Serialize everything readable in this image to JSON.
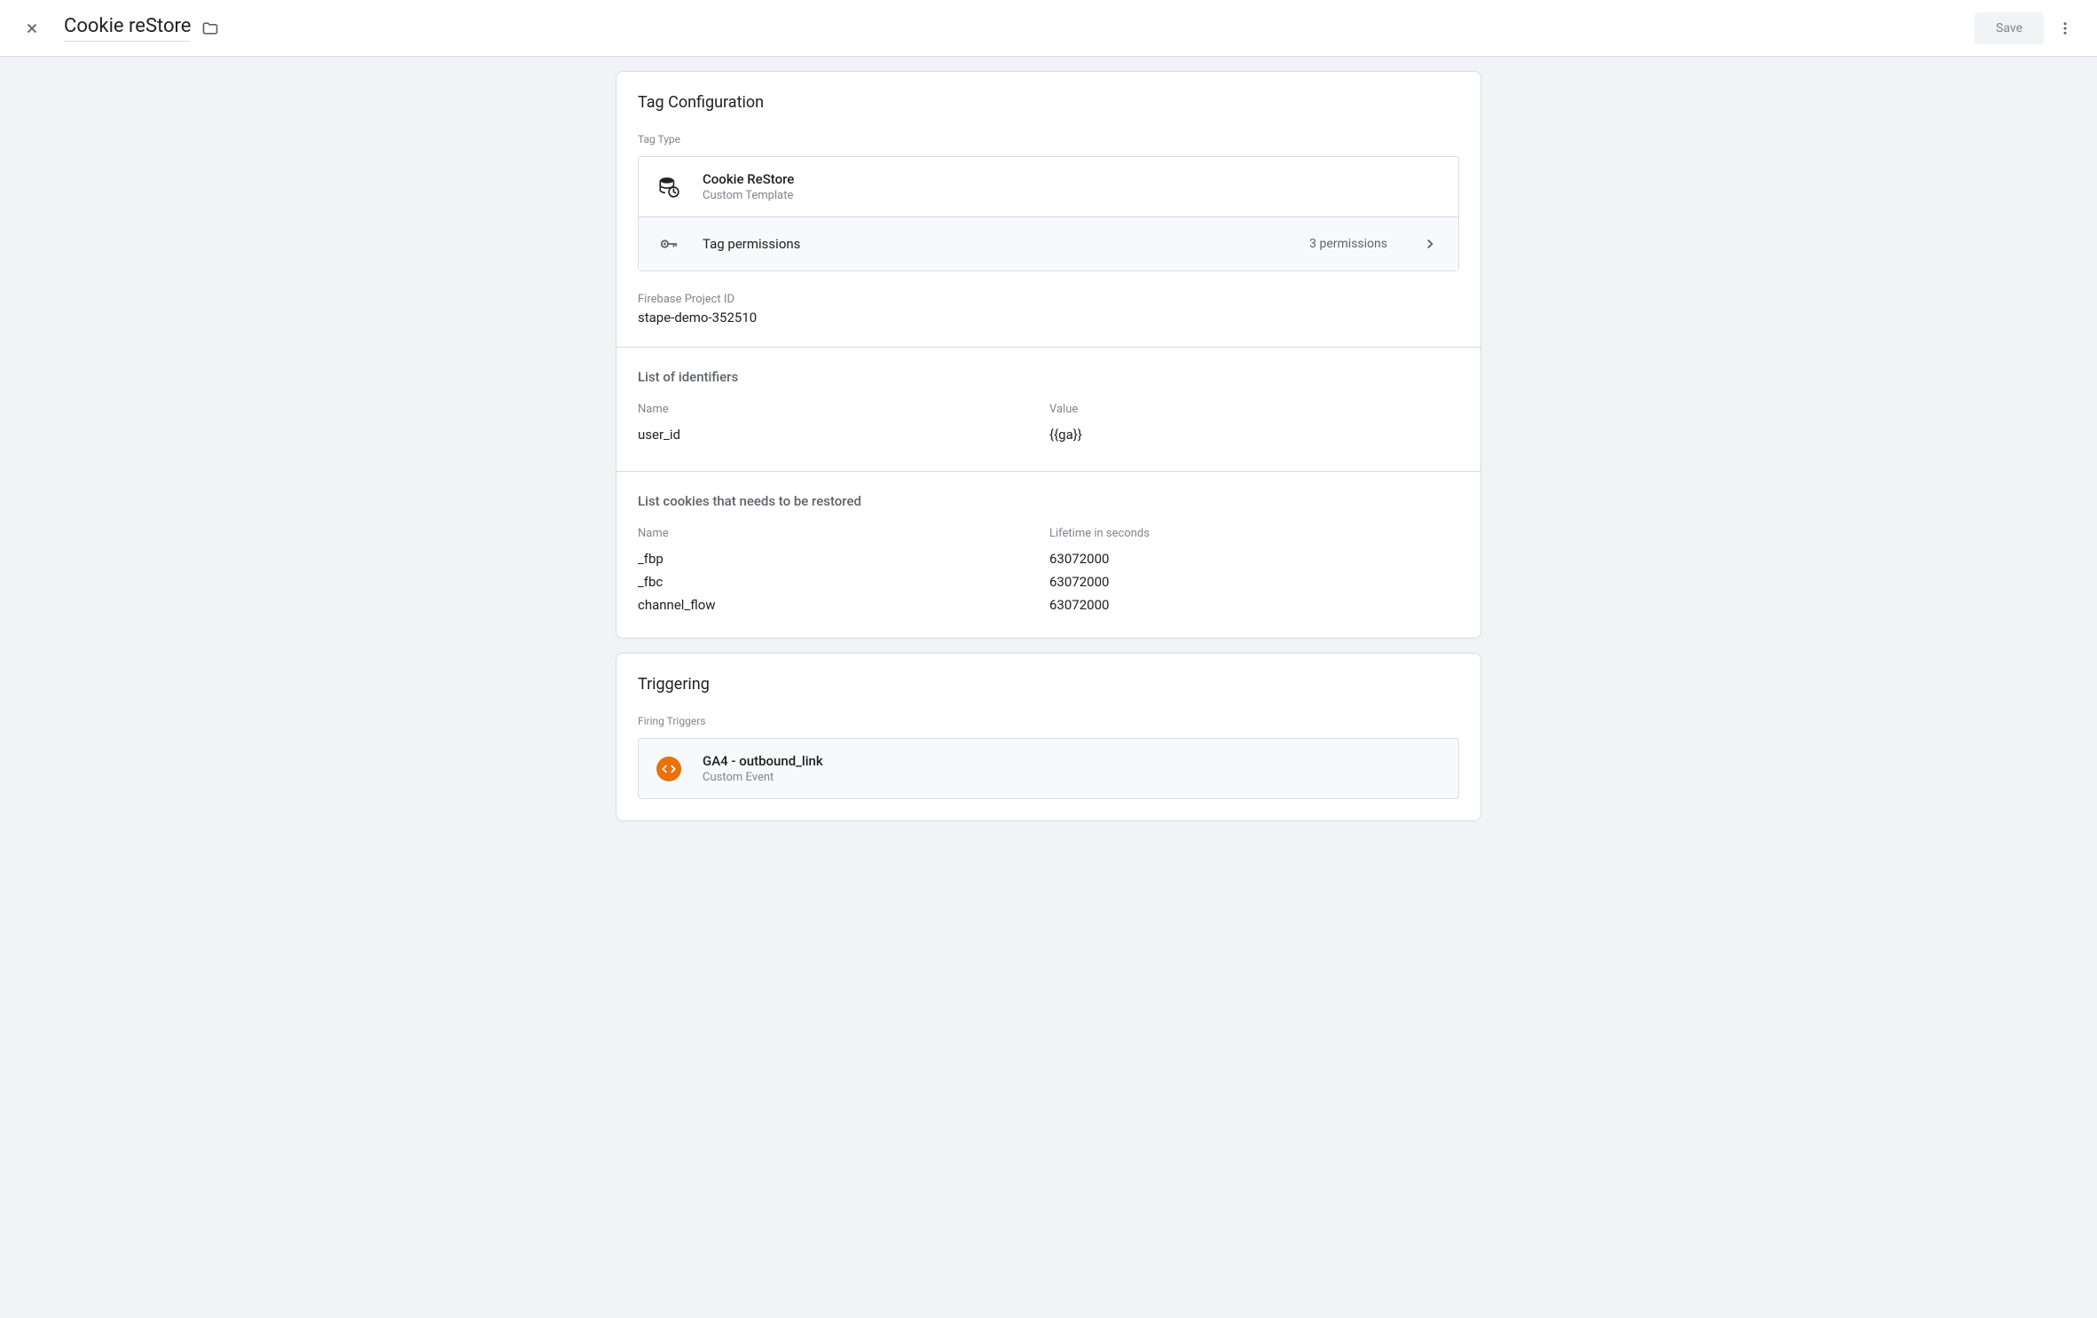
{
  "header": {
    "title": "Cookie reStore",
    "save_label": "Save"
  },
  "tag_config": {
    "card_title": "Tag Configuration",
    "tag_type_label": "Tag Type",
    "tag_type_name": "Cookie ReStore",
    "tag_type_subtitle": "Custom Template",
    "permissions_label": "Tag permissions",
    "permissions_count": "3 permissions",
    "firebase": {
      "label": "Firebase Project ID",
      "value": "stape-demo-352510"
    },
    "identifiers": {
      "title": "List of identifiers",
      "columns": {
        "name": "Name",
        "value": "Value"
      },
      "rows": [
        {
          "name": "user_id",
          "value": "{{ga}}"
        }
      ]
    },
    "cookies": {
      "title": "List cookies that needs to be restored",
      "columns": {
        "name": "Name",
        "lifetime": "Lifetime in seconds"
      },
      "rows": [
        {
          "name": "_fbp",
          "lifetime": "63072000"
        },
        {
          "name": "_fbc",
          "lifetime": "63072000"
        },
        {
          "name": "channel_flow",
          "lifetime": "63072000"
        }
      ]
    }
  },
  "triggering": {
    "card_title": "Triggering",
    "firing_label": "Firing Triggers",
    "trigger_name": "GA4 - outbound_link",
    "trigger_subtitle": "Custom Event"
  }
}
